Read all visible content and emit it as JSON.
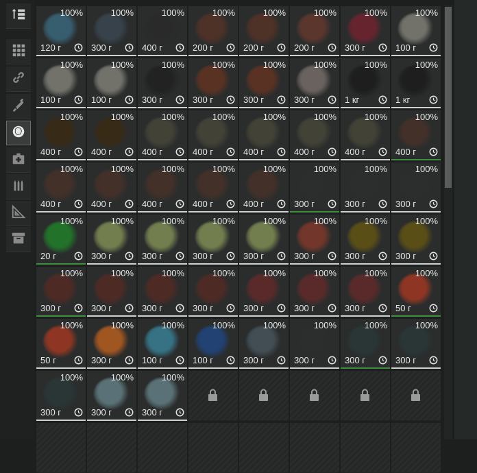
{
  "sidebar": {
    "items": [
      {
        "name": "sort-button",
        "icon": "sort-arrows-icon",
        "active": false
      },
      {
        "name": "category-all",
        "icon": "grid-icon",
        "active": false
      },
      {
        "name": "category-links",
        "icon": "chain-link-icon",
        "active": false
      },
      {
        "name": "category-weapons",
        "icon": "rifle-icon",
        "active": false
      },
      {
        "name": "category-artifacts",
        "icon": "artifact-sphere-icon",
        "active": true
      },
      {
        "name": "category-medkits",
        "icon": "medkit-icon",
        "active": false
      },
      {
        "name": "category-ammo",
        "icon": "ammo-icon",
        "active": false
      },
      {
        "name": "category-tools",
        "icon": "set-square-icon",
        "active": false
      },
      {
        "name": "category-storage",
        "icon": "storage-box-icon",
        "active": false
      }
    ]
  },
  "colors": {
    "text": "#e6e6e6",
    "cell_bg": "#2b2d2d",
    "underline_default": "#cfd2d2",
    "underline_green": "#3f8f3f"
  },
  "grid": {
    "items": [
      {
        "percent": "100%",
        "weight": "120 г",
        "color": "#3a6f86",
        "green": false
      },
      {
        "percent": "100%",
        "weight": "300 г",
        "color": "#3c4a55",
        "green": false
      },
      {
        "percent": "100%",
        "weight": "400 г",
        "color": "#2a2a2a",
        "green": false
      },
      {
        "percent": "100%",
        "weight": "200 г",
        "color": "#5a3326",
        "green": false
      },
      {
        "percent": "100%",
        "weight": "200 г",
        "color": "#5a3326",
        "green": false
      },
      {
        "percent": "100%",
        "weight": "200 г",
        "color": "#6a3a2e",
        "green": false
      },
      {
        "percent": "100%",
        "weight": "300 г",
        "color": "#7a2230",
        "green": false
      },
      {
        "percent": "100%",
        "weight": "100 г",
        "color": "#8a8a80",
        "green": false
      },
      {
        "percent": "100%",
        "weight": "100 г",
        "color": "#8a8a80",
        "green": false
      },
      {
        "percent": "100%",
        "weight": "100 г",
        "color": "#8a8a80",
        "green": false
      },
      {
        "percent": "100%",
        "weight": "300 г",
        "color": "#1f1f1f",
        "green": false
      },
      {
        "percent": "100%",
        "weight": "300 г",
        "color": "#6a3420",
        "green": false
      },
      {
        "percent": "100%",
        "weight": "300 г",
        "color": "#6a3420",
        "green": false
      },
      {
        "percent": "100%",
        "weight": "300 г",
        "color": "#7e7470",
        "green": false
      },
      {
        "percent": "100%",
        "weight": "1 кг",
        "color": "#1a1a1a",
        "green": false
      },
      {
        "percent": "100%",
        "weight": "1 кг",
        "color": "#1a1a1a",
        "green": false
      },
      {
        "percent": "100%",
        "weight": "400 г",
        "color": "#3b2a10",
        "green": false
      },
      {
        "percent": "100%",
        "weight": "400 г",
        "color": "#3b2a10",
        "green": false
      },
      {
        "percent": "100%",
        "weight": "400 г",
        "color": "#4a4a3a",
        "green": false
      },
      {
        "percent": "100%",
        "weight": "400 г",
        "color": "#4a4a3a",
        "green": false
      },
      {
        "percent": "100%",
        "weight": "400 г",
        "color": "#4a4a3a",
        "green": false
      },
      {
        "percent": "100%",
        "weight": "400 г",
        "color": "#4a4a3a",
        "green": false
      },
      {
        "percent": "100%",
        "weight": "400 г",
        "color": "#4a4a3a",
        "green": false
      },
      {
        "percent": "100%",
        "weight": "400 г",
        "color": "#4a3228",
        "green": true
      },
      {
        "percent": "100%",
        "weight": "400 г",
        "color": "#4a3228",
        "green": false
      },
      {
        "percent": "100%",
        "weight": "400 г",
        "color": "#4a3228",
        "green": false
      },
      {
        "percent": "100%",
        "weight": "400 г",
        "color": "#4a3228",
        "green": false
      },
      {
        "percent": "100%",
        "weight": "400 г",
        "color": "#4a3228",
        "green": false
      },
      {
        "percent": "100%",
        "weight": "400 г",
        "color": "#4a3228",
        "green": false
      },
      {
        "percent": "100%",
        "weight": "300 г",
        "color": "#2d2d2d",
        "green": true
      },
      {
        "percent": "100%",
        "weight": "300 г",
        "color": "#2d2d2d",
        "green": false
      },
      {
        "percent": "100%",
        "weight": "300 г",
        "color": "#2d2d2d",
        "green": false
      },
      {
        "percent": "100%",
        "weight": "20 г",
        "color": "#1f8a2a",
        "green": true
      },
      {
        "percent": "100%",
        "weight": "300 г",
        "color": "#8a9a5a",
        "green": false
      },
      {
        "percent": "100%",
        "weight": "300 г",
        "color": "#8a9a5a",
        "green": false
      },
      {
        "percent": "100%",
        "weight": "300 г",
        "color": "#8a9a5a",
        "green": false
      },
      {
        "percent": "100%",
        "weight": "300 г",
        "color": "#8a9a5a",
        "green": false
      },
      {
        "percent": "100%",
        "weight": "300 г",
        "color": "#8a3a2a",
        "green": false
      },
      {
        "percent": "100%",
        "weight": "300 г",
        "color": "#6a5a10",
        "green": false
      },
      {
        "percent": "100%",
        "weight": "300 г",
        "color": "#6a5a10",
        "green": false
      },
      {
        "percent": "100%",
        "weight": "300 г",
        "color": "#5a2a22",
        "green": true
      },
      {
        "percent": "100%",
        "weight": "300 г",
        "color": "#5a2a22",
        "green": false
      },
      {
        "percent": "100%",
        "weight": "300 г",
        "color": "#5a2a22",
        "green": false
      },
      {
        "percent": "100%",
        "weight": "300 г",
        "color": "#5a2a22",
        "green": false
      },
      {
        "percent": "100%",
        "weight": "300 г",
        "color": "#6a2a2a",
        "green": false
      },
      {
        "percent": "100%",
        "weight": "300 г",
        "color": "#6a2a2a",
        "green": false
      },
      {
        "percent": "100%",
        "weight": "300 г",
        "color": "#6a2a2a",
        "green": false
      },
      {
        "percent": "100%",
        "weight": "50 г",
        "color": "#b03a20",
        "green": true
      },
      {
        "percent": "100%",
        "weight": "50 г",
        "color": "#b03a20",
        "green": false
      },
      {
        "percent": "100%",
        "weight": "300 г",
        "color": "#c8641e",
        "green": false
      },
      {
        "percent": "100%",
        "weight": "100 г",
        "color": "#3a8aa0",
        "green": false
      },
      {
        "percent": "100%",
        "weight": "100 г",
        "color": "#1e4a8a",
        "green": false
      },
      {
        "percent": "100%",
        "weight": "300 г",
        "color": "#4a5a62",
        "green": false
      },
      {
        "percent": "100%",
        "weight": "300 г",
        "color": "#2d2d2d",
        "green": false
      },
      {
        "percent": "100%",
        "weight": "300 г",
        "color": "#2a3a3a",
        "green": true
      },
      {
        "percent": "100%",
        "weight": "300 г",
        "color": "#2a3a3a",
        "green": false
      },
      {
        "percent": "100%",
        "weight": "300 г",
        "color": "#2a3a3a",
        "green": false
      },
      {
        "percent": "100%",
        "weight": "300 г",
        "color": "#6a8a90",
        "green": false
      },
      {
        "percent": "100%",
        "weight": "300 г",
        "color": "#6a8a90",
        "green": false
      }
    ],
    "locked_slots": 5,
    "locked_icon": "lock-icon"
  }
}
